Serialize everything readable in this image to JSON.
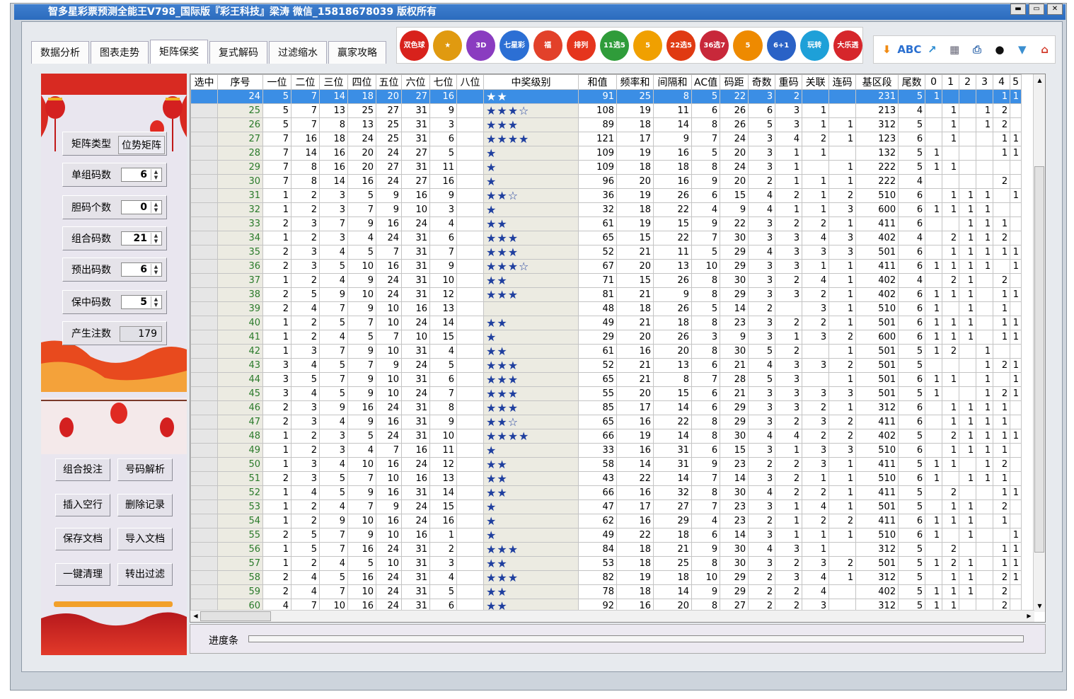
{
  "title": "智多星彩票预测全能王V798_国际版『彩王科技』梁涛 微信_15818678039 版权所有",
  "window_buttons": [
    "▬",
    "▭",
    "✕"
  ],
  "tabs": [
    "数据分析",
    "图表走势",
    "矩阵保奖",
    "复式解码",
    "过滤缩水",
    "赢家攻略"
  ],
  "active_tab": "矩阵保奖",
  "lottery_icons": [
    {
      "label": "双色球",
      "color": "#d8221c"
    },
    {
      "label": "★",
      "color": "#e09a10"
    },
    {
      "label": "3D",
      "color": "#8a3cc0"
    },
    {
      "label": "七星彩",
      "color": "#2c6fd4"
    },
    {
      "label": "福",
      "color": "#e2412a"
    },
    {
      "label": "排列",
      "color": "#e5351d"
    },
    {
      "label": "11选5",
      "color": "#2f9c3a"
    },
    {
      "label": "5",
      "color": "#f0a000"
    },
    {
      "label": "22选5",
      "color": "#e03a12"
    },
    {
      "label": "36选7",
      "color": "#c8283a"
    },
    {
      "label": "5",
      "color": "#ee8a00"
    },
    {
      "label": "6+1",
      "color": "#2a62c6"
    },
    {
      "label": "玩转",
      "color": "#1ea0d8"
    },
    {
      "label": "大乐透",
      "color": "#d6262b"
    }
  ],
  "toolbar_icons": [
    {
      "name": "down-arrow-icon",
      "glyph": "⬇",
      "color": "#f08a12"
    },
    {
      "name": "spellcheck-icon",
      "glyph": "ABC",
      "color": "#2a6fd0"
    },
    {
      "name": "export-icon",
      "glyph": "↗",
      "color": "#2a8ad0"
    },
    {
      "name": "calculator-icon",
      "glyph": "▦",
      "color": "#667"
    },
    {
      "name": "print-icon",
      "glyph": "⎙",
      "color": "#3b6fb0"
    },
    {
      "name": "qq-icon",
      "glyph": "●",
      "color": "#111"
    },
    {
      "name": "basket-icon",
      "glyph": "▼",
      "color": "#3b8fd0"
    },
    {
      "name": "home-icon",
      "glyph": "⌂",
      "color": "#d23a2a"
    }
  ],
  "left": {
    "controls": [
      {
        "label": "矩阵类型",
        "value": "位势矩阵",
        "kind": "text"
      },
      {
        "label": "单组码数",
        "value": "6",
        "kind": "spin"
      },
      {
        "label": "胆码个数",
        "value": "0",
        "kind": "spin"
      },
      {
        "label": "组合码数",
        "value": "21",
        "kind": "spin"
      },
      {
        "label": "预出码数",
        "value": "6",
        "kind": "spin"
      },
      {
        "label": "保中码数",
        "value": "5",
        "kind": "spin"
      },
      {
        "label": "产生注数",
        "value": "179",
        "kind": "value"
      }
    ],
    "buttons": [
      "组合投注",
      "号码解析",
      "插入空行",
      "删除记录",
      "保存文档",
      "导入文档",
      "一键清理",
      "转出过滤"
    ]
  },
  "table": {
    "headers": [
      "选中",
      "序号",
      "一位",
      "二位",
      "三位",
      "四位",
      "五位",
      "六位",
      "七位",
      "八位",
      "中奖级别",
      "和值",
      "频率和",
      "间隔和",
      "AC值",
      "码距",
      "奇数",
      "重码",
      "关联",
      "连码",
      "基区段",
      "尾数",
      "0",
      "1",
      "2",
      "3",
      "4",
      "5"
    ],
    "selected_row": 0,
    "rows": [
      [
        "",
        "24",
        "5",
        "7",
        "14",
        "18",
        "20",
        "27",
        "16",
        "",
        "★★",
        "91",
        "25",
        "8",
        "5",
        "22",
        "3",
        "2",
        "",
        "",
        "231",
        "5",
        "1",
        "",
        "",
        "",
        "1",
        "1"
      ],
      [
        "",
        "25",
        "5",
        "7",
        "13",
        "25",
        "27",
        "31",
        "9",
        "",
        "★★★☆",
        "108",
        "19",
        "11",
        "6",
        "26",
        "6",
        "3",
        "1",
        "",
        "213",
        "4",
        "",
        "1",
        "",
        "1",
        "2",
        ""
      ],
      [
        "",
        "26",
        "5",
        "7",
        "8",
        "13",
        "25",
        "31",
        "3",
        "",
        "★★★",
        "89",
        "18",
        "14",
        "8",
        "26",
        "5",
        "3",
        "1",
        "1",
        "312",
        "5",
        "",
        "1",
        "",
        "1",
        "2",
        ""
      ],
      [
        "",
        "27",
        "7",
        "16",
        "18",
        "24",
        "25",
        "31",
        "6",
        "",
        "★★★★",
        "121",
        "17",
        "9",
        "7",
        "24",
        "3",
        "4",
        "2",
        "1",
        "123",
        "6",
        "",
        "1",
        "",
        "",
        "1",
        "1"
      ],
      [
        "",
        "28",
        "7",
        "14",
        "16",
        "20",
        "24",
        "27",
        "5",
        "",
        "★",
        "109",
        "19",
        "16",
        "5",
        "20",
        "3",
        "1",
        "1",
        "",
        "132",
        "5",
        "1",
        "",
        "",
        "",
        "1",
        "1"
      ],
      [
        "",
        "29",
        "7",
        "8",
        "16",
        "20",
        "27",
        "31",
        "11",
        "",
        "★",
        "109",
        "18",
        "18",
        "8",
        "24",
        "3",
        "1",
        "",
        "1",
        "222",
        "5",
        "1",
        "1",
        "",
        "",
        "",
        ""
      ],
      [
        "",
        "30",
        "7",
        "8",
        "14",
        "16",
        "24",
        "27",
        "16",
        "",
        "★",
        "96",
        "20",
        "16",
        "9",
        "20",
        "2",
        "1",
        "1",
        "1",
        "222",
        "4",
        "",
        "",
        "",
        "",
        "2",
        ""
      ],
      [
        "",
        "31",
        "1",
        "2",
        "3",
        "5",
        "9",
        "16",
        "9",
        "",
        "★★☆",
        "36",
        "19",
        "26",
        "6",
        "15",
        "4",
        "2",
        "1",
        "2",
        "510",
        "6",
        "",
        "1",
        "1",
        "1",
        "",
        "1"
      ],
      [
        "",
        "32",
        "1",
        "2",
        "3",
        "7",
        "9",
        "10",
        "3",
        "",
        "★",
        "32",
        "18",
        "22",
        "4",
        "9",
        "4",
        "1",
        "1",
        "3",
        "600",
        "6",
        "1",
        "1",
        "1",
        "1",
        "",
        ""
      ],
      [
        "",
        "33",
        "2",
        "3",
        "7",
        "9",
        "16",
        "24",
        "4",
        "",
        "★★",
        "61",
        "19",
        "15",
        "9",
        "22",
        "3",
        "2",
        "2",
        "1",
        "411",
        "6",
        "",
        "",
        "1",
        "1",
        "1",
        ""
      ],
      [
        "",
        "34",
        "1",
        "2",
        "3",
        "4",
        "24",
        "31",
        "6",
        "",
        "★★★",
        "65",
        "15",
        "22",
        "7",
        "30",
        "3",
        "3",
        "4",
        "3",
        "402",
        "4",
        "",
        "2",
        "1",
        "1",
        "2",
        ""
      ],
      [
        "",
        "35",
        "2",
        "3",
        "4",
        "5",
        "7",
        "31",
        "7",
        "",
        "★★★",
        "52",
        "21",
        "11",
        "5",
        "29",
        "4",
        "3",
        "3",
        "3",
        "501",
        "6",
        "",
        "1",
        "1",
        "1",
        "1",
        "1"
      ],
      [
        "",
        "36",
        "2",
        "3",
        "5",
        "10",
        "16",
        "31",
        "9",
        "",
        "★★★☆",
        "67",
        "20",
        "13",
        "10",
        "29",
        "3",
        "3",
        "1",
        "1",
        "411",
        "6",
        "1",
        "1",
        "1",
        "1",
        "",
        "1"
      ],
      [
        "",
        "37",
        "1",
        "2",
        "4",
        "9",
        "24",
        "31",
        "10",
        "",
        "★★",
        "71",
        "15",
        "26",
        "8",
        "30",
        "3",
        "2",
        "4",
        "1",
        "402",
        "4",
        "",
        "2",
        "1",
        "",
        "2",
        ""
      ],
      [
        "",
        "38",
        "2",
        "5",
        "9",
        "10",
        "24",
        "31",
        "12",
        "",
        "★★★",
        "81",
        "21",
        "9",
        "8",
        "29",
        "3",
        "3",
        "2",
        "1",
        "402",
        "6",
        "1",
        "1",
        "1",
        "",
        "1",
        "1"
      ],
      [
        "",
        "39",
        "2",
        "4",
        "7",
        "9",
        "10",
        "16",
        "13",
        "",
        "",
        "48",
        "18",
        "26",
        "5",
        "14",
        "2",
        "",
        "3",
        "1",
        "510",
        "6",
        "1",
        "",
        "1",
        "",
        "1",
        ""
      ],
      [
        "",
        "40",
        "1",
        "2",
        "5",
        "7",
        "10",
        "24",
        "14",
        "",
        "★★",
        "49",
        "21",
        "18",
        "8",
        "23",
        "3",
        "2",
        "2",
        "1",
        "501",
        "6",
        "1",
        "1",
        "1",
        "",
        "1",
        "1"
      ],
      [
        "",
        "41",
        "1",
        "2",
        "4",
        "5",
        "7",
        "10",
        "15",
        "",
        "★",
        "29",
        "20",
        "26",
        "3",
        "9",
        "3",
        "1",
        "3",
        "2",
        "600",
        "6",
        "1",
        "1",
        "1",
        "",
        "1",
        "1"
      ],
      [
        "",
        "42",
        "1",
        "3",
        "7",
        "9",
        "10",
        "31",
        "4",
        "",
        "★★",
        "61",
        "16",
        "20",
        "8",
        "30",
        "5",
        "2",
        "",
        "1",
        "501",
        "5",
        "1",
        "2",
        "",
        "1",
        "",
        ""
      ],
      [
        "",
        "43",
        "3",
        "4",
        "5",
        "7",
        "9",
        "24",
        "5",
        "",
        "★★★",
        "52",
        "21",
        "13",
        "6",
        "21",
        "4",
        "3",
        "3",
        "2",
        "501",
        "5",
        "",
        "",
        "",
        "1",
        "2",
        "1"
      ],
      [
        "",
        "44",
        "3",
        "5",
        "7",
        "9",
        "10",
        "31",
        "6",
        "",
        "★★★",
        "65",
        "21",
        "8",
        "7",
        "28",
        "5",
        "3",
        "",
        "1",
        "501",
        "6",
        "1",
        "1",
        "",
        "1",
        "",
        "1"
      ],
      [
        "",
        "45",
        "3",
        "4",
        "5",
        "9",
        "10",
        "24",
        "7",
        "",
        "★★★",
        "55",
        "20",
        "15",
        "6",
        "21",
        "3",
        "3",
        "3",
        "3",
        "501",
        "5",
        "1",
        "",
        "",
        "1",
        "2",
        "1"
      ],
      [
        "",
        "46",
        "2",
        "3",
        "9",
        "16",
        "24",
        "31",
        "8",
        "",
        "★★★",
        "85",
        "17",
        "14",
        "6",
        "29",
        "3",
        "3",
        "2",
        "1",
        "312",
        "6",
        "",
        "1",
        "1",
        "1",
        "1",
        ""
      ],
      [
        "",
        "47",
        "2",
        "3",
        "4",
        "9",
        "16",
        "31",
        "9",
        "",
        "★★☆",
        "65",
        "16",
        "22",
        "8",
        "29",
        "3",
        "2",
        "3",
        "2",
        "411",
        "6",
        "",
        "1",
        "1",
        "1",
        "1",
        ""
      ],
      [
        "",
        "48",
        "1",
        "2",
        "3",
        "5",
        "24",
        "31",
        "10",
        "",
        "★★★★",
        "66",
        "19",
        "14",
        "8",
        "30",
        "4",
        "4",
        "2",
        "2",
        "402",
        "5",
        "",
        "2",
        "1",
        "1",
        "1",
        "1"
      ],
      [
        "",
        "49",
        "1",
        "2",
        "3",
        "4",
        "7",
        "16",
        "11",
        "",
        "★",
        "33",
        "16",
        "31",
        "6",
        "15",
        "3",
        "1",
        "3",
        "3",
        "510",
        "6",
        "",
        "1",
        "1",
        "1",
        "1",
        ""
      ],
      [
        "",
        "50",
        "1",
        "3",
        "4",
        "10",
        "16",
        "24",
        "12",
        "",
        "★★",
        "58",
        "14",
        "31",
        "9",
        "23",
        "2",
        "2",
        "3",
        "1",
        "411",
        "5",
        "1",
        "1",
        "",
        "1",
        "2",
        ""
      ],
      [
        "",
        "51",
        "2",
        "3",
        "5",
        "7",
        "10",
        "16",
        "13",
        "",
        "★★",
        "43",
        "22",
        "14",
        "7",
        "14",
        "3",
        "2",
        "1",
        "1",
        "510",
        "6",
        "1",
        "",
        "1",
        "1",
        "1",
        ""
      ],
      [
        "",
        "52",
        "1",
        "4",
        "5",
        "9",
        "16",
        "31",
        "14",
        "",
        "★★",
        "66",
        "16",
        "32",
        "8",
        "30",
        "4",
        "2",
        "2",
        "1",
        "411",
        "5",
        "",
        "2",
        "",
        "",
        "1",
        "1"
      ],
      [
        "",
        "53",
        "1",
        "2",
        "4",
        "7",
        "9",
        "24",
        "15",
        "",
        "★",
        "47",
        "17",
        "27",
        "7",
        "23",
        "3",
        "1",
        "4",
        "1",
        "501",
        "5",
        "",
        "1",
        "1",
        "",
        "2",
        ""
      ],
      [
        "",
        "54",
        "1",
        "2",
        "9",
        "10",
        "16",
        "24",
        "16",
        "",
        "★",
        "62",
        "16",
        "29",
        "4",
        "23",
        "2",
        "1",
        "2",
        "2",
        "411",
        "6",
        "1",
        "1",
        "1",
        "",
        "1",
        ""
      ],
      [
        "",
        "55",
        "2",
        "5",
        "7",
        "9",
        "10",
        "16",
        "1",
        "",
        "★",
        "49",
        "22",
        "18",
        "6",
        "14",
        "3",
        "1",
        "1",
        "1",
        "510",
        "6",
        "1",
        "",
        "1",
        "",
        "",
        "1"
      ],
      [
        "",
        "56",
        "1",
        "5",
        "7",
        "16",
        "24",
        "31",
        "2",
        "",
        "★★★",
        "84",
        "18",
        "21",
        "9",
        "30",
        "4",
        "3",
        "1",
        "",
        "312",
        "5",
        "",
        "2",
        "",
        "",
        "1",
        "1"
      ],
      [
        "",
        "57",
        "1",
        "2",
        "4",
        "5",
        "10",
        "31",
        "3",
        "",
        "★★",
        "53",
        "18",
        "25",
        "8",
        "30",
        "3",
        "2",
        "3",
        "2",
        "501",
        "5",
        "1",
        "2",
        "1",
        "",
        "1",
        "1"
      ],
      [
        "",
        "58",
        "2",
        "4",
        "5",
        "16",
        "24",
        "31",
        "4",
        "",
        "★★★",
        "82",
        "19",
        "18",
        "10",
        "29",
        "2",
        "3",
        "4",
        "1",
        "312",
        "5",
        "",
        "1",
        "1",
        "",
        "2",
        "1"
      ],
      [
        "",
        "59",
        "2",
        "4",
        "7",
        "10",
        "24",
        "31",
        "5",
        "",
        "★★",
        "78",
        "18",
        "14",
        "9",
        "29",
        "2",
        "2",
        "4",
        "",
        "402",
        "5",
        "1",
        "1",
        "1",
        "",
        "2",
        ""
      ],
      [
        "",
        "60",
        "4",
        "7",
        "10",
        "16",
        "24",
        "31",
        "6",
        "",
        "★★",
        "92",
        "16",
        "20",
        "8",
        "27",
        "2",
        "2",
        "3",
        "",
        "312",
        "5",
        "1",
        "1",
        "",
        "",
        "2",
        ""
      ]
    ]
  },
  "progress_label": "进度条"
}
